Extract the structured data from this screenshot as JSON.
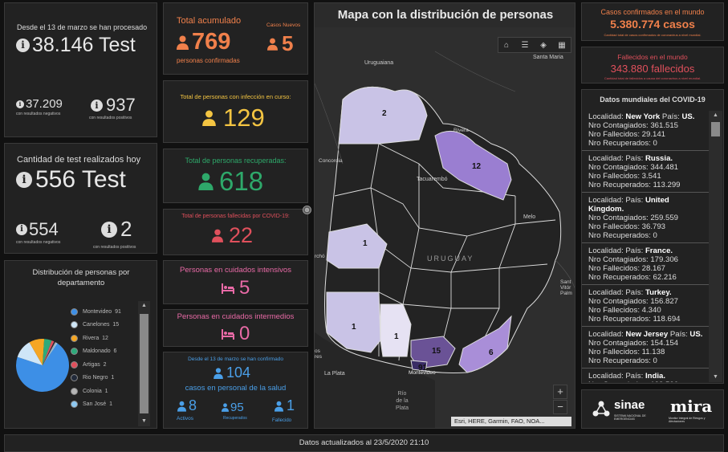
{
  "tests_total": {
    "caption": "Desde el 13 de marzo se han procesado",
    "value": "38.146 Test",
    "negatives_value": "37.209",
    "negatives_label": "con resultados negativos",
    "positives_value": "937",
    "positives_label": "con resultados positivos"
  },
  "tests_today": {
    "caption": "Cantidad de test realizados hoy",
    "value": "556 Test",
    "negatives_value": "554",
    "negatives_label": "con resultados negativos",
    "positives_value": "2",
    "positives_label": "con resultados positivos"
  },
  "accumulated": {
    "title": "Total acumulado",
    "value": "769",
    "label": "personas confirmadas",
    "new_title": "Casos Nuevos",
    "new_value": "5"
  },
  "active": {
    "title": "Total de personas con infección en curso:",
    "value": "129"
  },
  "recovered": {
    "title": "Total de personas recuperadas:",
    "value": "618"
  },
  "deceased": {
    "title": "Total de personas fallecidas por COVID-19:",
    "value": "22"
  },
  "icu": {
    "title": "Personas en cuidados intensivos",
    "value": "5"
  },
  "intermediate": {
    "title": "Personas en cuidados intermedios",
    "value": "0"
  },
  "health_staff": {
    "caption": "Desde el 13 de marzo se han confirmado",
    "value": "104",
    "label": "casos en personal de la salud",
    "active_value": "8",
    "active_label": "Activos",
    "recovered_value": "95",
    "recovered_label": "Recuperados",
    "deceased_value": "1",
    "deceased_label": "Fallecido"
  },
  "departments_chart": {
    "title": "Distribución de personas por departamento"
  },
  "chart_data": {
    "type": "pie",
    "title": "Distribución de personas por departamento",
    "categories": [
      "Montevideo",
      "Canelones",
      "Rivera",
      "Maldonado",
      "Artigas",
      "Rio Negro",
      "Colonia",
      "San José"
    ],
    "values": [
      91,
      15,
      12,
      6,
      2,
      1,
      1,
      1
    ],
    "colors": [
      "#3d8fe6",
      "#cfe6f7",
      "#f5a623",
      "#2eaa7a",
      "#e0505c",
      "#222a3a",
      "#b5b5b5",
      "#8ec8f0"
    ]
  },
  "map": {
    "title": "Mapa con la distribución de personas",
    "attribution": "Esri, HERE, Garmin, FAO, NOA...",
    "labels": {
      "uruguaiana": "Uruguaiana",
      "santa_maria": "Santa Maria",
      "rivera": "Rivera",
      "concordia": "Concordia",
      "tacuarembo": "Tacuarembó",
      "melo": "Melo",
      "uruguay": "URUGUAY",
      "la_plata": "La Plata",
      "rio_plata": "Río\nde la\nPlata",
      "montevideo": "Montevideo",
      "cho": "rchó",
      "santa_vitoria": "Sant\nVitór\nPalm",
      "aires": "os\nres"
    },
    "counts": {
      "artigas": "2",
      "rivera": "12",
      "rio_negro": "1",
      "colonia": "1",
      "san_jose": "1",
      "canelones": "15",
      "maldonado": "6",
      "montevideo": "91"
    },
    "zoom_in": "+",
    "zoom_out": "−"
  },
  "world_confirmed": {
    "title": "Casos confirmados en el mundo",
    "value": "5.380.774 casos",
    "note": "Cantidad total de casos confirmados de coronavirus a nivel mundial."
  },
  "world_deaths": {
    "title": "Fallecidos en el mundo",
    "value": "343.880 fallecidos",
    "note": "Cantidad total de fallecidos a causa del coronavirus a nivel mundial."
  },
  "world_list": {
    "title": "Datos mundiales del COVID-19",
    "items": [
      {
        "loc": "Localidad:",
        "name": "New York",
        "pais_label": "País:",
        "country": "US.",
        "c": "Nro Contagiados: 361.515",
        "f": "Nro Fallecidos: 29.141",
        "r": "Nro Recuperados: 0"
      },
      {
        "loc": "Localidad:",
        "name": "",
        "pais_label": "País:",
        "country": "Russia.",
        "c": "Nro Contagiados: 344.481",
        "f": "Nro Fallecidos: 3.541",
        "r": "Nro Recuperados: 113.299"
      },
      {
        "loc": "Localidad:",
        "name": "",
        "pais_label": "País:",
        "country": "United Kingdom.",
        "c": "Nro Contagiados: 259.559",
        "f": "Nro Fallecidos: 36.793",
        "r": "Nro Recuperados: 0"
      },
      {
        "loc": "Localidad:",
        "name": "",
        "pais_label": "País:",
        "country": "France.",
        "c": "Nro Contagiados: 179.306",
        "f": "Nro Fallecidos: 28.167",
        "r": "Nro Recuperados: 62.216"
      },
      {
        "loc": "Localidad:",
        "name": "",
        "pais_label": "País:",
        "country": "Turkey.",
        "c": "Nro Contagiados: 156.827",
        "f": "Nro Fallecidos: 4.340",
        "r": "Nro Recuperados: 118.694"
      },
      {
        "loc": "Localidad:",
        "name": "New Jersey",
        "pais_label": "País:",
        "country": "US.",
        "c": "Nro Contagiados: 154.154",
        "f": "Nro Fallecidos: 11.138",
        "r": "Nro Recuperados: 0"
      },
      {
        "loc": "Localidad:",
        "name": "",
        "pais_label": "País:",
        "country": "India.",
        "c": "Nro Contagiados: 138.536",
        "f": "",
        "r": ""
      }
    ]
  },
  "logos": {
    "sinae": "sinae",
    "sinae_sub": "SISTEMA NACIONAL DE EMERGENCIAS",
    "mira": "mira",
    "mira_sub": "Monitor Integral de Riesgos y Afectaciones"
  },
  "footer": {
    "text": "Datos actualizados al 23/5/2020 21:10"
  }
}
